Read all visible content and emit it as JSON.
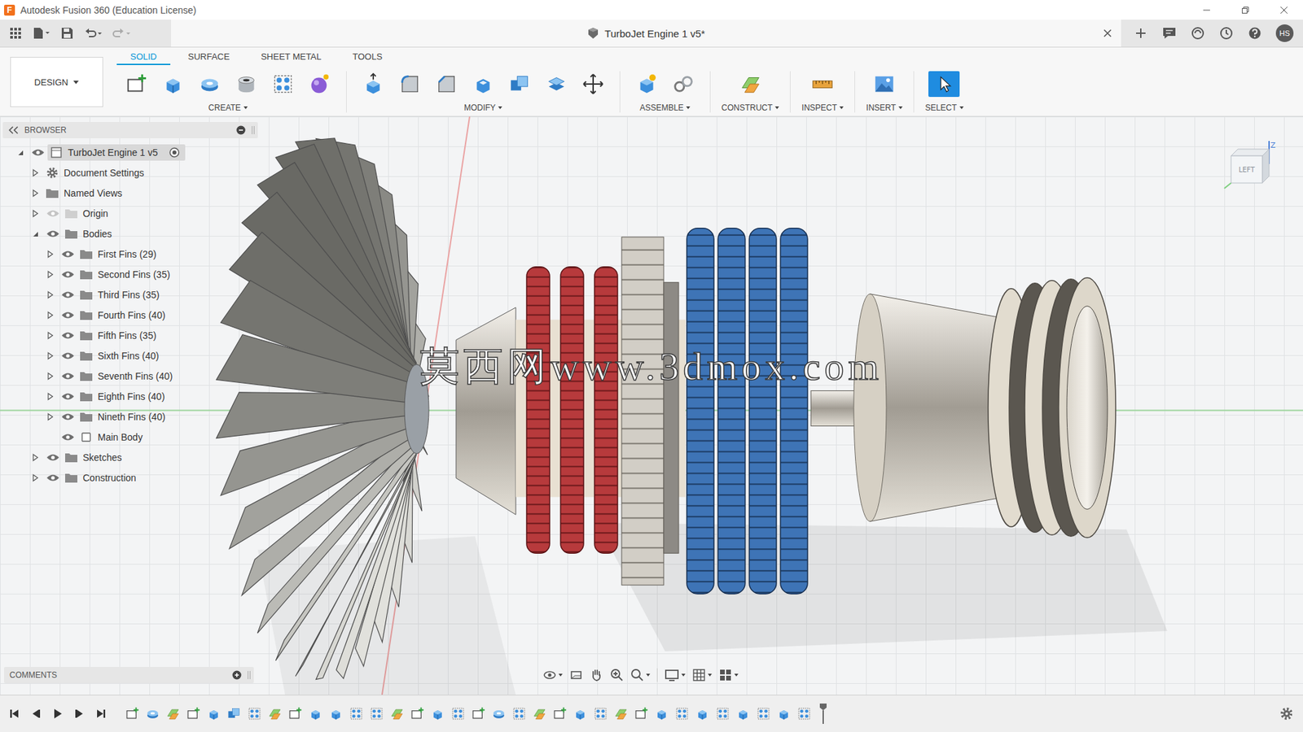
{
  "window": {
    "title": "Autodesk Fusion 360 (Education License)",
    "logo": "F"
  },
  "document_tab": {
    "title": "TurboJet Engine 1 v5*",
    "selected": true
  },
  "user": {
    "initials": "HS"
  },
  "workspace": {
    "label": "DESIGN"
  },
  "toolbar_tabs": [
    {
      "label": "SOLID",
      "selected": true
    },
    {
      "label": "SURFACE",
      "selected": false
    },
    {
      "label": "SHEET METAL",
      "selected": false
    },
    {
      "label": "TOOLS",
      "selected": false
    }
  ],
  "toolbar_groups": [
    {
      "label": "CREATE",
      "tools": [
        {
          "kind": "sketch",
          "selected": false
        },
        {
          "kind": "extrude",
          "selected": false
        },
        {
          "kind": "revolve",
          "selected": false
        },
        {
          "kind": "hole",
          "selected": false
        },
        {
          "kind": "pattern",
          "selected": false
        },
        {
          "kind": "form",
          "selected": false
        }
      ]
    },
    {
      "label": "MODIFY",
      "tools": [
        {
          "kind": "presspull",
          "selected": false
        },
        {
          "kind": "fillet",
          "selected": false
        },
        {
          "kind": "chamfer",
          "selected": false
        },
        {
          "kind": "shell",
          "selected": false
        },
        {
          "kind": "combine",
          "selected": false
        },
        {
          "kind": "offset",
          "selected": false
        },
        {
          "kind": "move",
          "selected": false
        }
      ]
    },
    {
      "label": "ASSEMBLE",
      "tools": [
        {
          "kind": "component",
          "selected": false
        },
        {
          "kind": "joint",
          "selected": false
        }
      ]
    },
    {
      "label": "CONSTRUCT",
      "tools": [
        {
          "kind": "plane",
          "selected": false
        }
      ]
    },
    {
      "label": "INSPECT",
      "tools": [
        {
          "kind": "measure",
          "selected": false
        }
      ]
    },
    {
      "label": "INSERT",
      "tools": [
        {
          "kind": "image",
          "selected": false
        }
      ]
    },
    {
      "label": "SELECT",
      "tools": [
        {
          "kind": "select",
          "selected": true
        }
      ]
    }
  ],
  "browser": {
    "title": "BROWSER",
    "root": {
      "label": "TurboJet Engine 1 v5",
      "expanded": true,
      "visible": true,
      "active": true
    },
    "items": [
      {
        "label": "Document Settings",
        "kind": "settings",
        "expanded": false
      },
      {
        "label": "Named Views",
        "kind": "folder",
        "expanded": false
      },
      {
        "label": "Origin",
        "kind": "folder",
        "expanded": false,
        "visible": false
      },
      {
        "label": "Bodies",
        "kind": "folder",
        "expanded": true,
        "visible": true,
        "children": [
          {
            "label": "First Fins (29)",
            "kind": "folder",
            "expanded": false,
            "visible": true
          },
          {
            "label": "Second Fins (35)",
            "kind": "folder",
            "expanded": false,
            "visible": true
          },
          {
            "label": "Third Fins (35)",
            "kind": "folder",
            "expanded": false,
            "visible": true
          },
          {
            "label": "Fourth Fins (40)",
            "kind": "folder",
            "expanded": false,
            "visible": true
          },
          {
            "label": "Fifth Fins (35)",
            "kind": "folder",
            "expanded": false,
            "visible": true
          },
          {
            "label": "Sixth Fins (40)",
            "kind": "folder",
            "expanded": false,
            "visible": true
          },
          {
            "label": "Seventh Fins (40)",
            "kind": "folder",
            "expanded": false,
            "visible": true
          },
          {
            "label": "Eighth Fins (40)",
            "kind": "folder",
            "expanded": false,
            "visible": true
          },
          {
            "label": "Nineth Fins (40)",
            "kind": "folder",
            "expanded": false,
            "visible": true
          },
          {
            "label": "Main Body",
            "kind": "body",
            "visible": true
          }
        ]
      },
      {
        "label": "Sketches",
        "kind": "folder",
        "expanded": false,
        "visible": true
      },
      {
        "label": "Construction",
        "kind": "folder",
        "expanded": false,
        "visible": true
      }
    ]
  },
  "comments": {
    "title": "COMMENTS"
  },
  "watermark": "莫西网www.3dmox.com",
  "view_cube": {
    "face": "LEFT",
    "axis": "Z"
  },
  "timeline": {
    "features": [
      {
        "kind": "sketch"
      },
      {
        "kind": "revolve"
      },
      {
        "kind": "plane"
      },
      {
        "kind": "sketch"
      },
      {
        "kind": "extrude"
      },
      {
        "kind": "combine"
      },
      {
        "kind": "pattern"
      },
      {
        "kind": "plane"
      },
      {
        "kind": "sketch"
      },
      {
        "kind": "extrude"
      },
      {
        "kind": "extrude"
      },
      {
        "kind": "pattern"
      },
      {
        "kind": "pattern"
      },
      {
        "kind": "plane"
      },
      {
        "kind": "sketch"
      },
      {
        "kind": "extrude"
      },
      {
        "kind": "pattern"
      },
      {
        "kind": "sketch"
      },
      {
        "kind": "revolve"
      },
      {
        "kind": "pattern"
      },
      {
        "kind": "plane"
      },
      {
        "kind": "sketch"
      },
      {
        "kind": "extrude"
      },
      {
        "kind": "pattern"
      },
      {
        "kind": "plane"
      },
      {
        "kind": "sketch"
      },
      {
        "kind": "extrude"
      },
      {
        "kind": "pattern"
      },
      {
        "kind": "extrude"
      },
      {
        "kind": "pattern"
      },
      {
        "kind": "extrude"
      },
      {
        "kind": "pattern"
      },
      {
        "kind": "extrude"
      },
      {
        "kind": "pattern"
      }
    ]
  }
}
